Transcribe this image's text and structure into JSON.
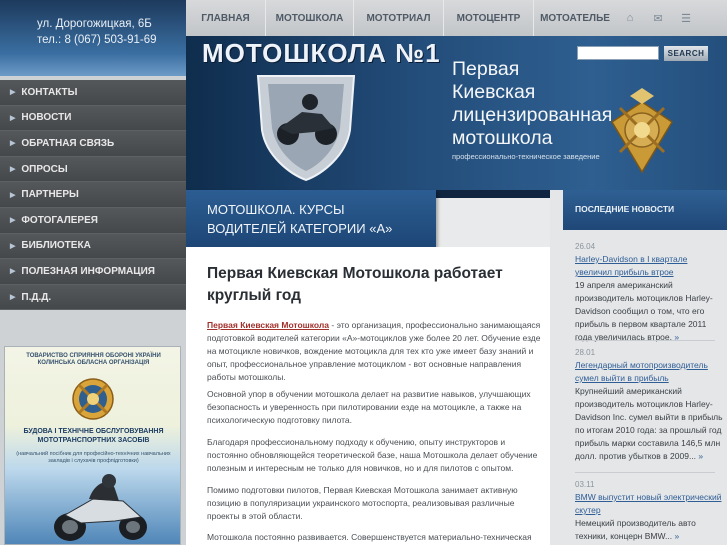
{
  "address": {
    "street": "ул. Дорогожицкая, 6Б",
    "phone": "тел.: 8 (067) 503-91-69"
  },
  "sidebar": {
    "items": [
      {
        "label": "КОНТАКТЫ"
      },
      {
        "label": "НОВОСТИ"
      },
      {
        "label": "ОБРАТНАЯ СВЯЗЬ"
      },
      {
        "label": "ОПРОСЫ"
      },
      {
        "label": "ПАРТНЕРЫ"
      },
      {
        "label": "ФОТОГАЛЕРЕЯ"
      },
      {
        "label": "БИБЛИОТЕКА"
      },
      {
        "label": "ПОЛЕЗНАЯ ИНФОРМАЦИЯ"
      },
      {
        "label": "П.Д.Д."
      }
    ]
  },
  "book": {
    "org": "ТОВАРИСТВО СПРИЯННЯ ОБОРОНІ УКРАЇНИ КОЛИНСЬКА ОБЛАСНА ОРГАНІЗАЦІЯ",
    "title": "БУДОВА І ТЕХНІЧНЕ ОБСЛУГОВУВАННЯ МОТОТРАНСПОРТНИХ ЗАСОБІВ",
    "subtitle": "(навчальний посібник для професійно-технічних навчальних закладів і слухачів профпідготовки)"
  },
  "topnav": {
    "items": [
      {
        "label": "ГЛАВНАЯ"
      },
      {
        "label": "МОТОШКОЛА"
      },
      {
        "label": "МОТОТРИАЛ"
      },
      {
        "label": "МОТОЦЕНТР"
      },
      {
        "label": "МОТОАТЕЛЬЕ"
      }
    ],
    "icons": [
      "home-icon",
      "mail-icon",
      "sitemap-icon"
    ]
  },
  "header": {
    "logo": "МОТОШКОЛА №1",
    "title_lines": [
      "Первая",
      "Киевская",
      "лицензированная",
      "мотошкола"
    ],
    "subtitle": "профессионально-техническое заведение",
    "search_button": "SEARCH",
    "search_value": ""
  },
  "banner": {
    "line1": "МОТОШКОЛА. КУРСЫ",
    "line2": "ВОДИТЕЛЕЙ КАТЕГОРИИ «А»"
  },
  "main": {
    "title": "Первая Киевская Мотошкола работает круглый год",
    "p1_lead": "Первая Киевская Мотошкола",
    "p1": " - это организация, профессионально занимающаяся подготовкой водителей категории «А»-мотоциклов уже более 20 лет. Обучение езде на мотоцикле новичков, вождение мотоцикла для тех кто уже имеет базу знаний и опыт, профессиональное управление мотоциклом - вот основные направления работы мотошколы.",
    "p2": "Основной упор в обучении мотошкола делает на развитие навыков, улучшающих безопасность и уверенность при пилотировании езде на мотоцикле, а также на психологическую подготовку пилота.",
    "p3": "Благодаря профессиональному подходу к обучению, опыту инструкторов и постоянно обновляющейся теоретической базе, наша Мотошкола делает обучение полезным и интересным не только для новичков, но и для пилотов с опытом.",
    "p4": "Помимо подготовки пилотов, Первая Киевская Мотошкола занимает активную позицию в популяризации украинского мотоспорта, реализовывая различные проекты в этой области.",
    "p5": "Мотошкола постоянно развивается. Совершенствуется материально-техническая"
  },
  "news": {
    "heading": "ПОСЛЕДНИЕ НОВОСТИ",
    "items": [
      {
        "date": "26.04",
        "title": "Harley-Davidson в I квартале увеличил прибыль втрое",
        "text": "19 апреля американский производитель мотоциклов Harley-Davidson сообщил о том, что его прибыль в первом квартале 2011 года увеличилась втрое.",
        "more": "»"
      },
      {
        "date": "28.01",
        "title": "Легендарный мотопроизводитель сумел выйти в прибыль",
        "text": "Крупнейший американский производитель мотоциклов Harley-Davidson Inc. сумел выйти в прибыль по итогам 2010 года: за прошлый год прибыль марки составила 146,5 млн долл. против убытков в 2009...",
        "more": "»"
      },
      {
        "date": "03.11",
        "title": "BMW выпустит новый электрический скутер",
        "text": "Немецкий производитель авто техники, концерн BMW...",
        "more": "»"
      }
    ]
  },
  "colors": {
    "header_blue": "#224b78",
    "sidebar_gray": "#4a4d50",
    "link_blue": "#2f5e96",
    "lead_red": "#a1302b"
  }
}
